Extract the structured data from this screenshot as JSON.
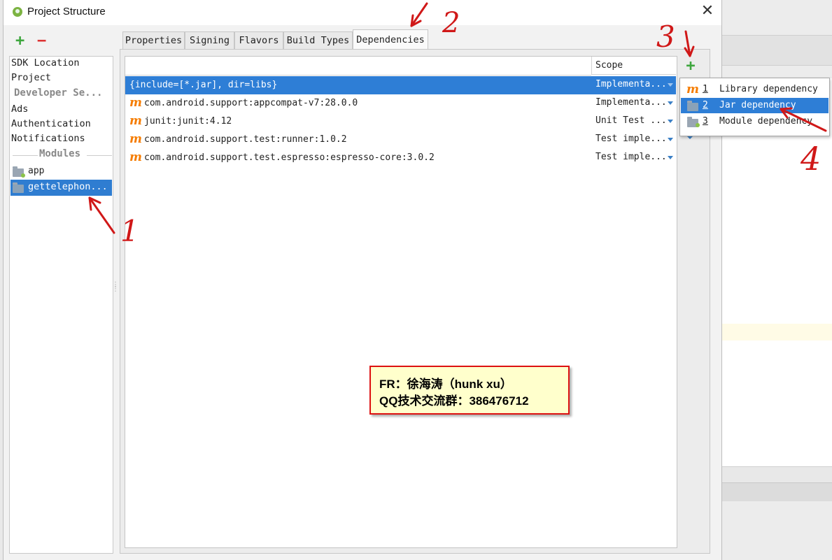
{
  "window": {
    "title": "Project Structure",
    "close": "✕"
  },
  "toolbar": {
    "add": "+",
    "remove": "−"
  },
  "sidebar": {
    "items": [
      "SDK Location",
      "Project",
      "Developer Se...",
      "Ads",
      "Authentication",
      "Notifications"
    ],
    "modules_heading": "Modules",
    "modules": [
      "app",
      "gettelephon..."
    ]
  },
  "tabs": [
    "Properties",
    "Signing",
    "Flavors",
    "Build Types",
    "Dependencies"
  ],
  "active_tab": "Dependencies",
  "table": {
    "columns": [
      "",
      "Scope"
    ],
    "rows": [
      {
        "name": "{include=[*.jar], dir=libs}",
        "scope": "Implementa...",
        "icon": "jar-icon"
      },
      {
        "name": "com.android.support:appcompat-v7:28.0.0",
        "scope": "Implementa...",
        "icon": "maven-icon"
      },
      {
        "name": "junit:junit:4.12",
        "scope": "Unit Test ...",
        "icon": "maven-icon"
      },
      {
        "name": "com.android.support.test:runner:1.0.2",
        "scope": "Test imple...",
        "icon": "maven-icon"
      },
      {
        "name": "com.android.support.test.espresso:espresso-core:3.0.2",
        "scope": "Test imple...",
        "icon": "maven-icon"
      }
    ]
  },
  "add_dependency": "+",
  "popup": {
    "items": [
      {
        "num": "1",
        "label": "Library dependency",
        "icon": "maven-icon"
      },
      {
        "num": "2",
        "label": "Jar dependency",
        "icon": "jar-folder-icon"
      },
      {
        "num": "3",
        "label": "Module dependency",
        "icon": "module-folder-icon"
      }
    ]
  },
  "note": {
    "line1": "FR：徐海涛（hunk xu）",
    "line2": "QQ技术交流群：386476712"
  },
  "annotations": [
    "1",
    "2",
    "3",
    "4"
  ],
  "colors": {
    "selection": "#2e7ed6",
    "annotation": "#d01818",
    "add": "#3ea63e",
    "maven": "#f57c00"
  }
}
